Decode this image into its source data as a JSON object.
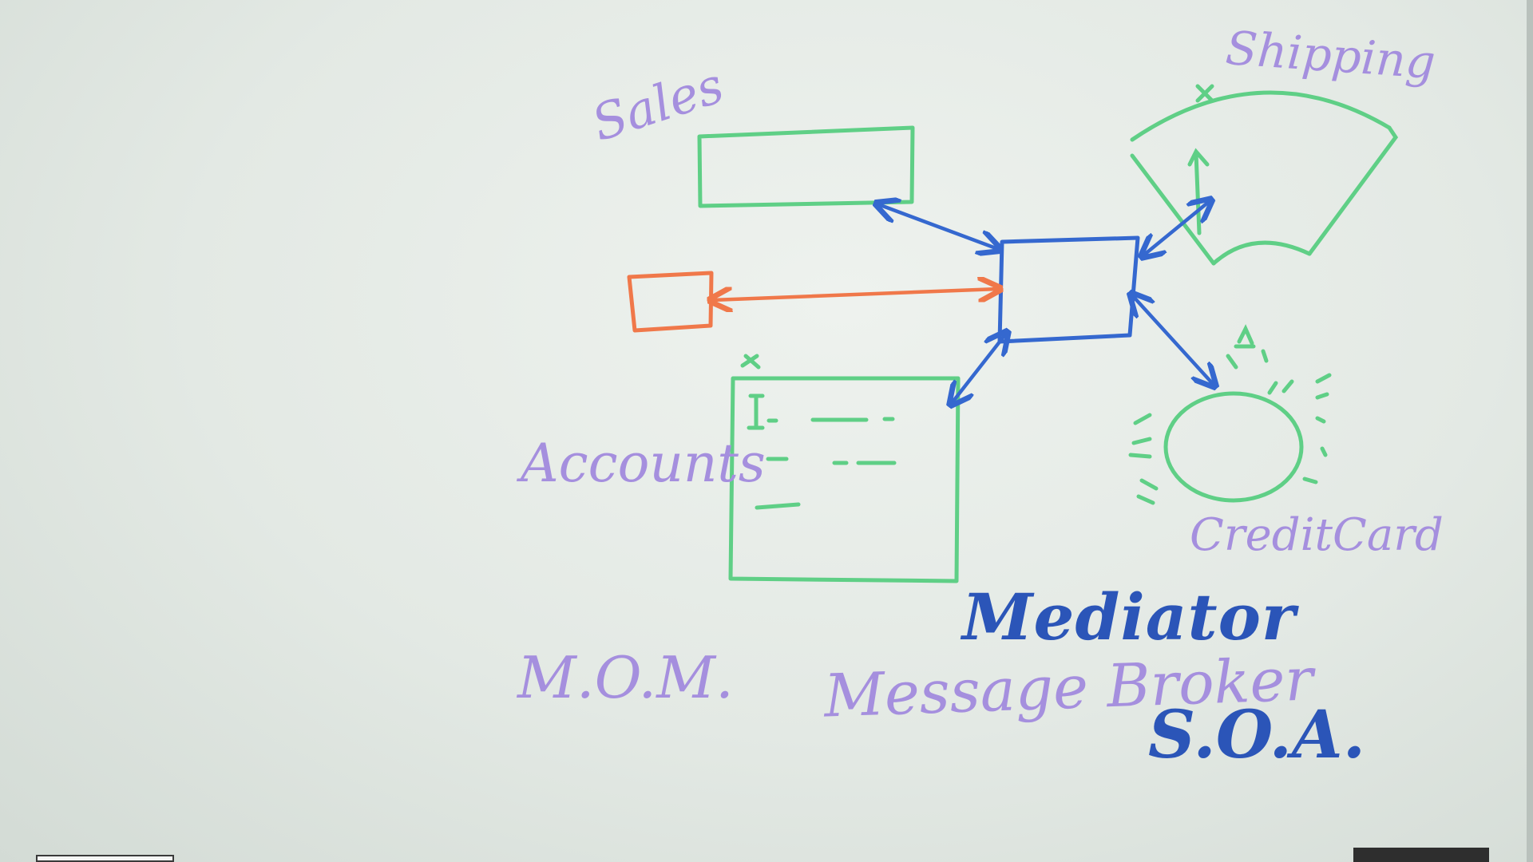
{
  "whiteboard": {
    "labels": {
      "sales": "Sales",
      "shipping": "Shipping",
      "accounts": "Accounts",
      "credit_card": "CreditCard",
      "mediator": "Mediator",
      "mom": "M.O.M.",
      "message_broker": "Message Broker",
      "soa": "S.O.A."
    },
    "colors": {
      "green": "#5fcf86",
      "blue": "#3568cf",
      "orange": "#f0784a",
      "purple": "#a58fde",
      "dark_blue": "#2b55b8"
    }
  }
}
